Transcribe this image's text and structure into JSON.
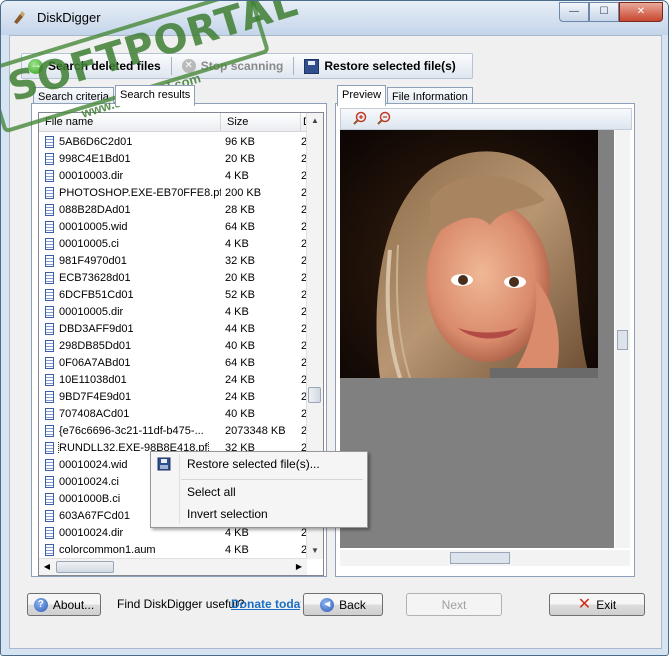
{
  "window": {
    "title": "DiskDigger",
    "minimize": "—",
    "maximize": "☐",
    "close": "✕"
  },
  "toolbar": {
    "search_label": "Search deleted files",
    "stop_label": "Stop scanning",
    "restore_label": "Restore selected file(s)"
  },
  "left_tabs": [
    "Search criteria",
    "Search results"
  ],
  "results": {
    "columns": [
      "File name",
      "Size",
      "D"
    ],
    "rows": [
      {
        "name": "5AB6D6C2d01",
        "size": "96 KB",
        "date": "2"
      },
      {
        "name": "998C4E1Bd01",
        "size": "20 KB",
        "date": "2"
      },
      {
        "name": "00010003.dir",
        "size": "4 KB",
        "date": "2"
      },
      {
        "name": "PHOTOSHOP.EXE-EB70FFE8.pf",
        "size": "200 KB",
        "date": "2"
      },
      {
        "name": "088B28DAd01",
        "size": "28 KB",
        "date": "2"
      },
      {
        "name": "00010005.wid",
        "size": "64 KB",
        "date": "2"
      },
      {
        "name": "00010005.ci",
        "size": "4 KB",
        "date": "2"
      },
      {
        "name": "981F4970d01",
        "size": "32 KB",
        "date": "2"
      },
      {
        "name": "ECB73628d01",
        "size": "20 KB",
        "date": "2"
      },
      {
        "name": "6DCFB51Cd01",
        "size": "52 KB",
        "date": "2"
      },
      {
        "name": "00010005.dir",
        "size": "4 KB",
        "date": "2"
      },
      {
        "name": "DBD3AFF9d01",
        "size": "44 KB",
        "date": "2"
      },
      {
        "name": "298DB85Dd01",
        "size": "40 KB",
        "date": "2"
      },
      {
        "name": "0F06A7ABd01",
        "size": "64 KB",
        "date": "2"
      },
      {
        "name": "10E11038d01",
        "size": "24 KB",
        "date": "2"
      },
      {
        "name": "9BD7F4E9d01",
        "size": "24 KB",
        "date": "2"
      },
      {
        "name": "707408ACd01",
        "size": "40 KB",
        "date": "2"
      },
      {
        "name": "{e76c6696-3c21-11df-b475-...",
        "size": "2073348 KB",
        "date": "2"
      },
      {
        "name": "RUNDLL32.EXE-98B8E418.pf",
        "size": "32 KB",
        "date": "2"
      },
      {
        "name": "00010024.wid",
        "size": "",
        "date": ""
      },
      {
        "name": "00010024.ci",
        "size": "",
        "date": ""
      },
      {
        "name": "0001000B.ci",
        "size": "",
        "date": ""
      },
      {
        "name": "603A67FCd01",
        "size": "",
        "date": ""
      },
      {
        "name": "00010024.dir",
        "size": "4 KB",
        "date": "2"
      },
      {
        "name": "colorcommon1.aum",
        "size": "4 KB",
        "date": "2"
      }
    ]
  },
  "right_tabs": [
    "Preview",
    "File Information"
  ],
  "context_menu": {
    "restore": "Restore selected file(s)...",
    "select_all": "Select all",
    "invert": "Invert selection"
  },
  "bottom": {
    "about": "About...",
    "useful": "Find DiskDigger useful?",
    "donate": "Donate today!",
    "back": "Back",
    "next": "Next",
    "exit": "Exit"
  },
  "watermark": {
    "brand": "SOFTPORTAL",
    "url": "www.softportal.com",
    "tm": "TM"
  },
  "colors": {
    "accent": "#1a6fc4",
    "stamp": "#3f7f33",
    "preview_bg": "#808080"
  }
}
